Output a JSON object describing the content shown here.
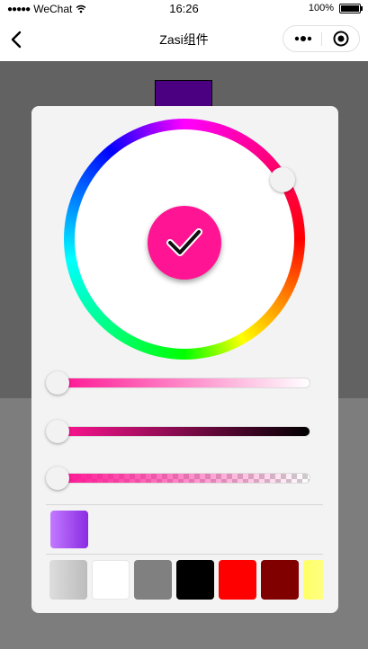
{
  "status_bar": {
    "signal_dots": "●●●●●",
    "carrier": "WeChat",
    "time": "16:26",
    "battery_percent": "100%",
    "battery_level": 1.0
  },
  "nav": {
    "title": "Zasi组件",
    "icons": [
      "chevron-left-icon",
      "more-icon",
      "target-icon"
    ]
  },
  "colors": {
    "page_background": "#626262",
    "page_background_lower": "#7d7d7d",
    "preview_color": "#4b0082",
    "selected_color": "#ff1493",
    "panel_background": "#f3f3f3"
  },
  "picker": {
    "slider_values": {
      "lightness": 0,
      "darkness": 0,
      "alpha": 0
    },
    "history_colors": [
      [
        "#c27aff",
        "#8a2be2"
      ]
    ],
    "palette": [
      [
        "#dddddd",
        "#bcbcbc"
      ],
      [
        "#ffffff",
        "#ffffff"
      ],
      [
        "#808080",
        "#808080"
      ],
      [
        "#000000",
        "#000000"
      ],
      [
        "#ff0000",
        "#ff0000"
      ],
      [
        "#800000",
        "#800000"
      ],
      [
        "#ffff66",
        "#ffff99"
      ]
    ]
  }
}
